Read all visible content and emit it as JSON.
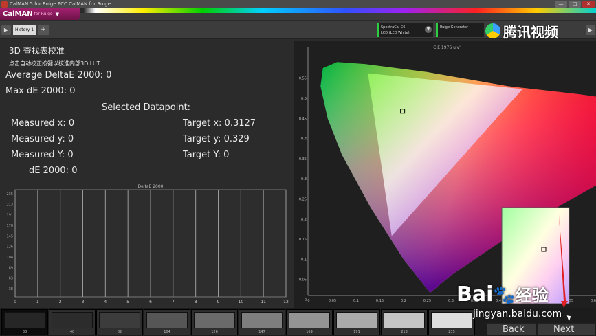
{
  "window": {
    "title": "CalMAN 5 for Ruige PCC CalMAN for Ruige",
    "controls": [
      "—",
      "□",
      "✕"
    ]
  },
  "brand": {
    "name": "CalMAN",
    "sub": "for Ruige"
  },
  "toolbar": {
    "history_tab": "History 1",
    "add_tab": "+",
    "meter_line1": "SpectraCal C6",
    "meter_line2": "LCD (LED White)",
    "generator_label": "Ruige Generator"
  },
  "watermark": {
    "tencent": "腾讯视频",
    "baidu_brand": "Bai",
    "baidu_cn": "经验",
    "baidu_url": "jingyan.baidu.com"
  },
  "panel": {
    "title": "3D 查找表校准",
    "subtitle": "点击自动校正按键以校准内部3D LUT",
    "avg_de": "Average DeltaE 2000: 0",
    "max_de": "Max dE 2000: 0",
    "selected": "Selected Datapoint:",
    "measured_x": "Measured x: 0",
    "measured_y": "Measured y: 0",
    "measured_Y": "Measured Y: 0",
    "de2000": "dE 2000: 0",
    "target_x": "Target x: 0.3127",
    "target_y": "Target y: 0.329",
    "target_Y": "Target Y: 0"
  },
  "chart_data": [
    {
      "type": "bar",
      "title": "DeltaE 2000",
      "x": [
        0,
        1,
        2,
        3,
        4,
        5,
        6,
        7,
        8,
        9,
        10,
        11,
        12
      ],
      "values": [],
      "xlim": [
        0,
        12
      ],
      "y_ticks": [
        "38",
        "63",
        "89",
        "104",
        "126",
        "145",
        "170",
        "191",
        "213",
        "235"
      ]
    },
    {
      "type": "scatter",
      "title": "CIE 1976 u'v'",
      "xlim": [
        0,
        0.65
      ],
      "ylim": [
        0,
        0.6
      ],
      "x_ticks": [
        "0",
        "0.05",
        "0.1",
        "0.15",
        "0.2",
        "0.25",
        "0.3",
        "0.35",
        "0.4",
        "0.45",
        "0.5",
        "0.55",
        "0.6",
        "0.65"
      ],
      "y_ticks": [
        "0",
        "0.05",
        "0.1",
        "0.15",
        "0.2",
        "0.25",
        "0.3",
        "0.35",
        "0.4",
        "0.45",
        "0.5",
        "0.55"
      ],
      "gamut": [
        [
          0.451,
          0.523
        ],
        [
          0.125,
          0.562
        ],
        [
          0.175,
          0.158
        ]
      ],
      "white_point": [
        0.198,
        0.468
      ]
    }
  ],
  "patches": [
    {
      "label": "38",
      "color": "#262626"
    },
    {
      "label": "40",
      "color": "#2c2c2c"
    },
    {
      "label": "82",
      "color": "#3c3c3c"
    },
    {
      "label": "104",
      "color": "#565656"
    },
    {
      "label": "126",
      "color": "#6a6a6a"
    },
    {
      "label": "147",
      "color": "#7e7e7e"
    },
    {
      "label": "169",
      "color": "#949494"
    },
    {
      "label": "191",
      "color": "#aaaaaa"
    },
    {
      "label": "213",
      "color": "#c4c4c4"
    },
    {
      "label": "235",
      "color": "#dedede"
    }
  ],
  "nav": {
    "back": "Back",
    "next": "Next"
  }
}
